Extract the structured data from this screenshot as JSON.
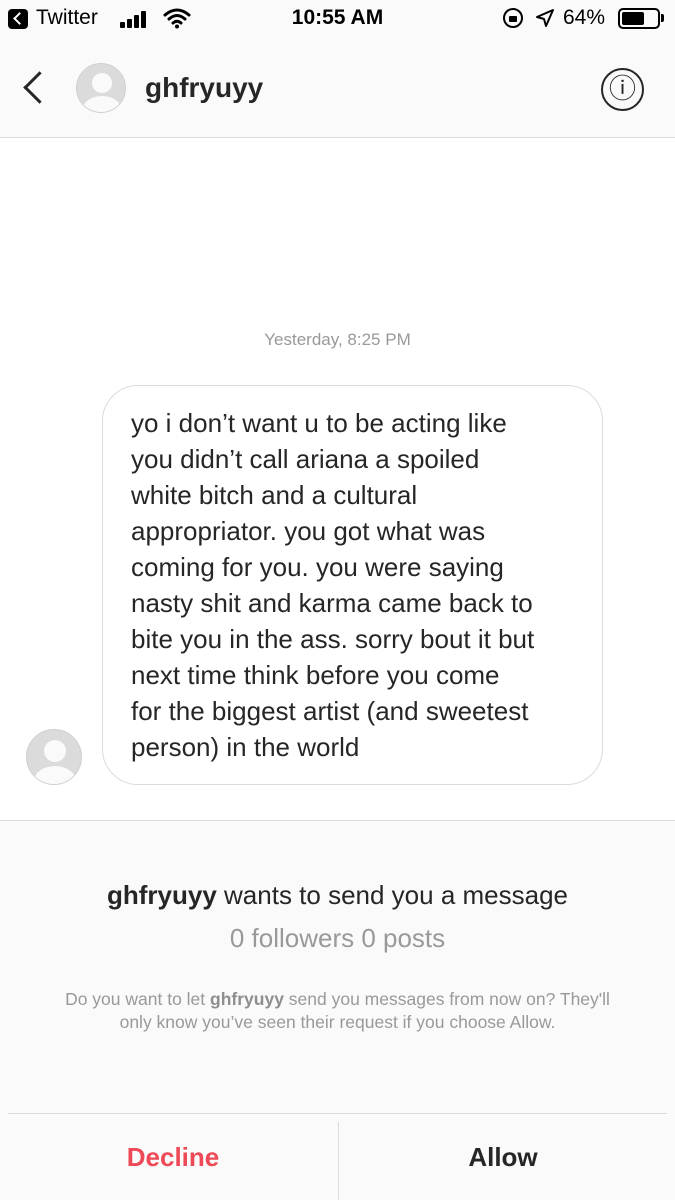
{
  "status_bar": {
    "back_app": "Twitter",
    "time": "10:55 AM",
    "battery_percent": "64%",
    "battery_level": 0.64,
    "icons": [
      "back-to-app-icon",
      "cellular-signal-icon",
      "wifi-icon",
      "orientation-lock-icon",
      "location-arrow-icon",
      "battery-icon"
    ]
  },
  "header": {
    "username": "ghfryuyy",
    "info_icon": "ⓘ"
  },
  "conversation": {
    "timestamp": "Yesterday, 8:25 PM",
    "message_lines": [
      "yo i don’t want u to be acting like",
      "you didn’t call ariana a spoiled",
      "white bitch and a cultural",
      "appropriator. you got what was",
      "coming for you. you were saying",
      "nasty shit and karma came back to",
      "bite you in the ass. sorry bout it but",
      "next time think before you come",
      "for the biggest artist (and sweetest",
      "person) in the world"
    ]
  },
  "request": {
    "title_username": "ghfryuyy",
    "title_rest": " wants to send you a message",
    "stats": "0 followers 0 posts",
    "body_pre": "Do you want to let ",
    "body_username": "ghfryuyy",
    "body_post": " send you messages from now on? They'll only know you’ve seen their request if you choose Allow.",
    "decline_label": "Decline",
    "allow_label": "Allow"
  },
  "colors": {
    "decline": "#ed4956",
    "text": "#262626",
    "secondary": "#999999",
    "panel_bg": "#fafafa",
    "border": "#dbdbdb"
  }
}
